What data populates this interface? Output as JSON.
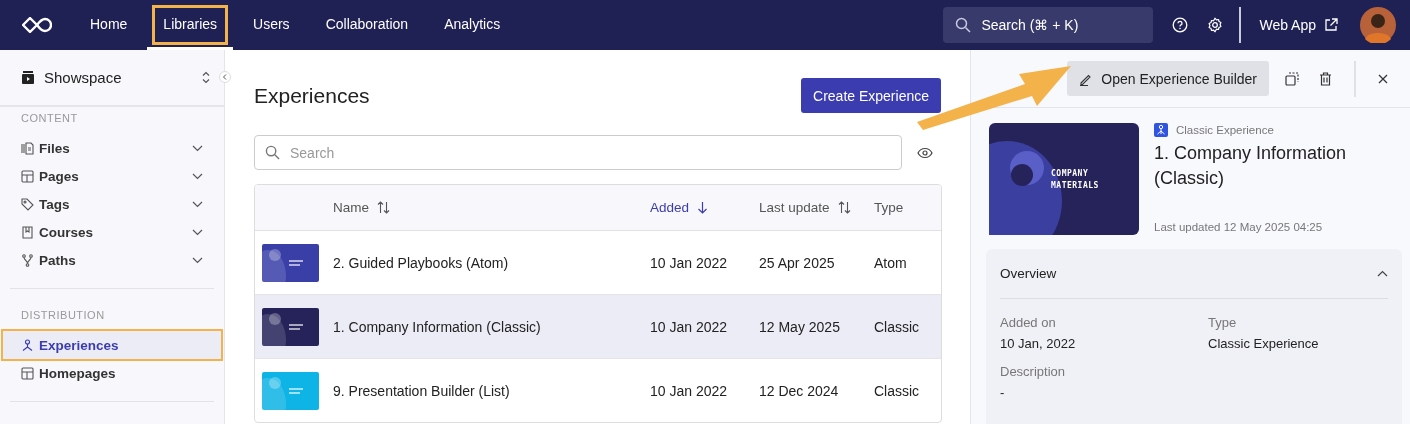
{
  "top_nav": {
    "items": [
      {
        "label": "Home",
        "selected": false,
        "highlighted": false
      },
      {
        "label": "Libraries",
        "selected": true,
        "highlighted": true
      },
      {
        "label": "Users",
        "selected": false,
        "highlighted": false
      },
      {
        "label": "Collaboration",
        "selected": false,
        "highlighted": false
      },
      {
        "label": "Analytics",
        "selected": false,
        "highlighted": false
      }
    ],
    "search": {
      "placeholder": "Search (⌘ + K)"
    },
    "web_app": "Web App"
  },
  "sidebar": {
    "workspace": "Showspace",
    "sections": [
      {
        "title": "CONTENT",
        "items": [
          {
            "label": "Files",
            "expandable": true,
            "selected": false,
            "highlighted": false
          },
          {
            "label": "Pages",
            "expandable": true,
            "selected": false,
            "highlighted": false
          },
          {
            "label": "Tags",
            "expandable": true,
            "selected": false,
            "highlighted": false
          },
          {
            "label": "Courses",
            "expandable": true,
            "selected": false,
            "highlighted": false
          },
          {
            "label": "Paths",
            "expandable": true,
            "selected": false,
            "highlighted": false
          }
        ]
      },
      {
        "title": "DISTRIBUTION",
        "items": [
          {
            "label": "Experiences",
            "expandable": false,
            "selected": true,
            "highlighted": true
          },
          {
            "label": "Homepages",
            "expandable": false,
            "selected": false,
            "highlighted": false
          }
        ]
      }
    ]
  },
  "main": {
    "title": "Experiences",
    "create_button": "Create Experience",
    "search": {
      "placeholder": "Search"
    },
    "table": {
      "columns": [
        {
          "label": "Name",
          "sortable": true,
          "active": false
        },
        {
          "label": "Added",
          "sortable": true,
          "active": true
        },
        {
          "label": "Last update",
          "sortable": true,
          "active": false
        },
        {
          "label": "Type",
          "sortable": false,
          "active": false
        }
      ],
      "rows": [
        {
          "name": "2. Guided Playbooks (Atom)",
          "added": "10 Jan 2022",
          "last_update": "25 Apr 2025",
          "type": "Atom",
          "selected": false,
          "color": "#3a3fa8"
        },
        {
          "name": "1. Company Information (Classic)",
          "added": "10 Jan 2022",
          "last_update": "12 May 2025",
          "type": "Classic",
          "selected": true,
          "color": "#26235a"
        },
        {
          "name": "9. Presentation Builder (List)",
          "added": "10 Jan 2022",
          "last_update": "12 Dec 2024",
          "type": "Classic",
          "selected": false,
          "color": "#0fb4e6"
        }
      ]
    }
  },
  "detail": {
    "open_button": "Open Experience Builder",
    "kind_label": "Classic Experience",
    "title": "1. Company Information (Classic)",
    "cover_text": "COMPANY MATERIALS",
    "last_updated": "Last updated 12 May 2025 04:25",
    "overview": {
      "title": "Overview",
      "expanded": true,
      "fields": [
        {
          "label": "Added on",
          "value": "10 Jan, 2022"
        },
        {
          "label": "Type",
          "value": "Classic Experience"
        },
        {
          "label": "Description",
          "value": "-"
        }
      ]
    }
  }
}
